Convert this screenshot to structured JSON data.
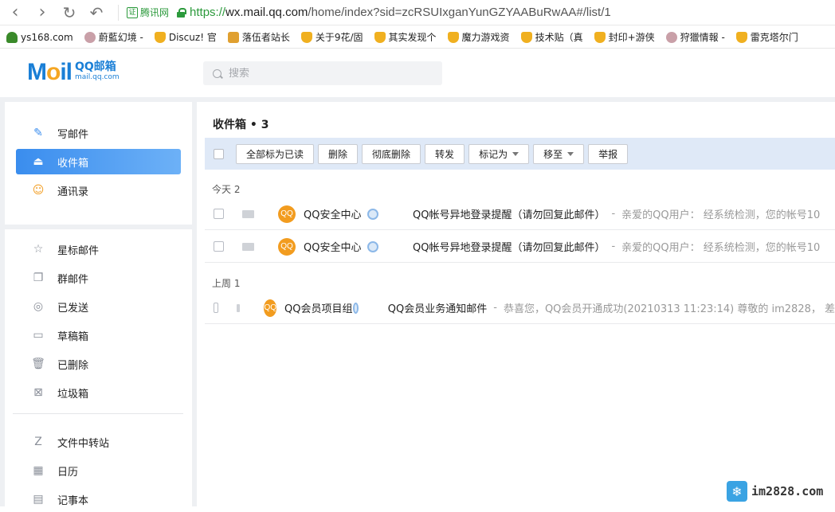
{
  "browser": {
    "nav_back": "‹",
    "nav_forward": "›",
    "reload": "↻",
    "undo": "↶",
    "site_badge_label": "腾讯网",
    "url_proto": "https://",
    "url_host": "wx.mail.qq.com",
    "url_path": "/home/index?sid=zcRSUIxganYunGZYAABuRwAA#/list/1",
    "bookmarks": [
      {
        "label": "ys168.com",
        "icon": "tree-icon"
      },
      {
        "label": "蔚藍幻境 -",
        "icon": "avatar-icon"
      },
      {
        "label": "Discuz! 官",
        "icon": "trophy-icon"
      },
      {
        "label": "落伍者站长",
        "icon": "fox-icon"
      },
      {
        "label": "关于9花/固",
        "icon": "trophy-icon"
      },
      {
        "label": "其实发现个",
        "icon": "trophy-icon"
      },
      {
        "label": "魔力游戏资",
        "icon": "trophy-icon"
      },
      {
        "label": "技术贴（真",
        "icon": "trophy-icon"
      },
      {
        "label": "封印+游侠",
        "icon": "trophy-icon"
      },
      {
        "label": "狩獵情報 -",
        "icon": "avatar-icon"
      },
      {
        "label": "雷克塔尔门",
        "icon": "trophy-icon"
      }
    ]
  },
  "header": {
    "logo_mark_m": "M",
    "logo_mark_o": "o",
    "logo_mark_il": "il",
    "logo_cn": "QQ邮箱",
    "logo_en": "mail.qq.com",
    "search_placeholder": "搜索"
  },
  "sidebar": {
    "primary": [
      {
        "label": "写邮件",
        "icon": "✎",
        "active": false
      },
      {
        "label": "收件箱",
        "icon": "⏏",
        "active": true
      },
      {
        "label": "通讯录",
        "icon": "☺",
        "active": false
      }
    ],
    "folders": [
      {
        "label": "星标邮件",
        "icon": "☆"
      },
      {
        "label": "群邮件",
        "icon": "❐"
      },
      {
        "label": "已发送",
        "icon": "◎"
      },
      {
        "label": "草稿箱",
        "icon": "▭"
      },
      {
        "label": "已删除",
        "icon": "🗑"
      },
      {
        "label": "垃圾箱",
        "icon": "⊠"
      }
    ],
    "tools": [
      {
        "label": "文件中转站",
        "icon": "Z"
      },
      {
        "label": "日历",
        "icon": "▦"
      },
      {
        "label": "记事本",
        "icon": "▤"
      }
    ]
  },
  "main": {
    "title": "收件箱 • 3",
    "toolbar": {
      "mark_all_read": "全部标为已读",
      "delete": "删除",
      "delete_permanently": "彻底删除",
      "forward": "转发",
      "mark_as": "标记为",
      "move_to": "移至",
      "report": "举报"
    },
    "groups": [
      {
        "label": "今天 2",
        "mails": [
          {
            "avatar": "QQ",
            "sender": "QQ安全中心",
            "subject": "QQ帐号异地登录提醒（请勿回复此邮件）",
            "dash": "-",
            "preview": "亲爱的QQ用户：      经系统检测，您的帐号10"
          },
          {
            "avatar": "QQ",
            "sender": "QQ安全中心",
            "subject": "QQ帐号异地登录提醒（请勿回复此邮件）",
            "dash": "-",
            "preview": "亲爱的QQ用户：      经系统检测，您的帐号10"
          }
        ]
      },
      {
        "label": "上周 1",
        "mails": [
          {
            "avatar": "QQ",
            "sender": "QQ会员项目组",
            "subject": "QQ会员业务通知邮件",
            "dash": "-",
            "preview": "恭喜您，QQ会员开通成功(20210313 11:23:14) 尊敬的 im2828， 差"
          }
        ]
      }
    ]
  },
  "watermark": {
    "text": "im2828.com",
    "icon": "❄"
  },
  "colors": {
    "accent": "#3a8dee",
    "toolbar_bg": "#dfe9f7",
    "avatar": "#f29c1f",
    "secure": "#2c9a3c"
  }
}
